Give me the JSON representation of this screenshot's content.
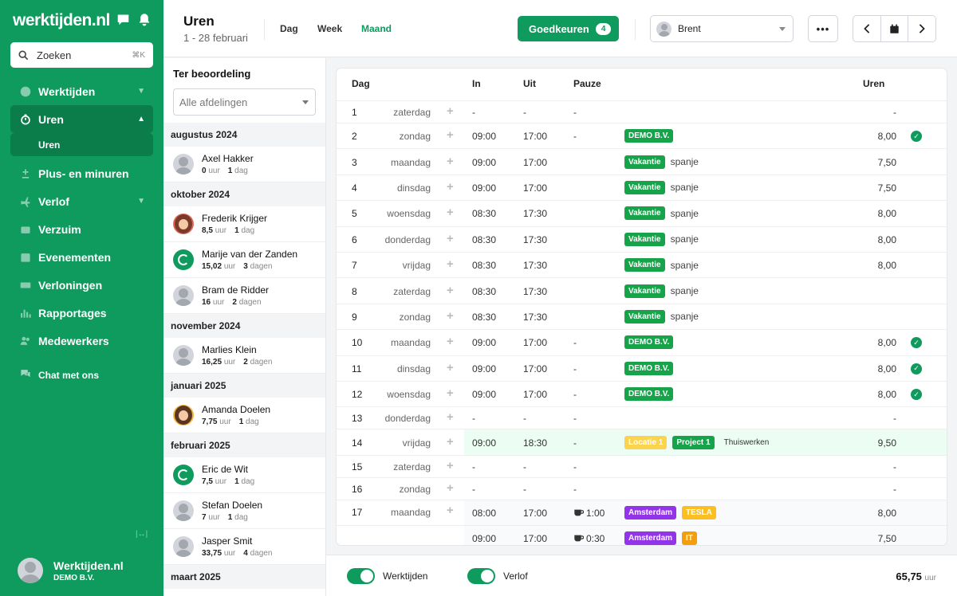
{
  "app": {
    "logo": "werktijden.nl"
  },
  "sidebar": {
    "search_label": "Zoeken",
    "search_shortcut": "⌘K",
    "items": [
      {
        "label": "Werktijden",
        "name": "werktijden"
      },
      {
        "label": "Uren",
        "name": "uren"
      },
      {
        "label": "Plus- en minuren",
        "name": "plus-minuren"
      },
      {
        "label": "Verlof",
        "name": "verlof"
      },
      {
        "label": "Verzuim",
        "name": "verzuim"
      },
      {
        "label": "Evenementen",
        "name": "evenementen"
      },
      {
        "label": "Verloningen",
        "name": "verloningen"
      },
      {
        "label": "Rapportages",
        "name": "rapportages"
      },
      {
        "label": "Medewerkers",
        "name": "medewerkers"
      }
    ],
    "sub_item": "Uren",
    "chat": "Chat met ons",
    "profile": {
      "name": "Werktijden.nl",
      "company": "DEMO B.V."
    }
  },
  "header": {
    "title": "Uren",
    "subtitle": "1 - 28 februari",
    "tabs": [
      "Dag",
      "Week",
      "Maand"
    ],
    "approve_label": "Goedkeuren",
    "approve_count": "4",
    "user": "Brent"
  },
  "review": {
    "title": "Ter beoordeling",
    "dept_placeholder": "Alle afdelingen",
    "unit_hours": "uur",
    "groups": [
      {
        "month": "augustus 2024",
        "people": [
          {
            "name": "Axel Hakker",
            "hours": "0",
            "days": "1 dag"
          }
        ]
      },
      {
        "month": "oktober 2024",
        "people": [
          {
            "name": "Frederik Krijger",
            "hours": "8,5",
            "days": "1 dag"
          },
          {
            "name": "Marije van der Zanden",
            "hours": "15,02",
            "days": "3 dagen"
          },
          {
            "name": "Bram de Ridder",
            "hours": "16",
            "days": "2 dagen"
          }
        ]
      },
      {
        "month": "november 2024",
        "people": [
          {
            "name": "Marlies Klein",
            "hours": "16,25",
            "days": "2 dagen"
          }
        ]
      },
      {
        "month": "januari 2025",
        "people": [
          {
            "name": "Amanda Doelen",
            "hours": "7,75",
            "days": "1 dag"
          }
        ]
      },
      {
        "month": "februari 2025",
        "people": [
          {
            "name": "Eric de Wit",
            "hours": "7,5",
            "days": "1 dag"
          },
          {
            "name": "Stefan Doelen",
            "hours": "7",
            "days": "1 dag"
          },
          {
            "name": "Jasper Smit",
            "hours": "33,75",
            "days": "4 dagen"
          }
        ]
      },
      {
        "month": "maart 2025",
        "people": []
      }
    ]
  },
  "table": {
    "headers": {
      "dag": "Dag",
      "in": "In",
      "uit": "Uit",
      "pauze": "Pauze",
      "uren": "Uren"
    },
    "rows": [
      {
        "num": "1",
        "day": "zaterdag",
        "in": "-",
        "out": "-",
        "pause": "-",
        "tags": [],
        "hours": "-",
        "check": false
      },
      {
        "num": "2",
        "day": "zondag",
        "in": "09:00",
        "out": "17:00",
        "pause": "-",
        "tags": [
          {
            "t": "DEMO B.V.",
            "c": "#16a34a"
          }
        ],
        "hours": "8,00",
        "check": true
      },
      {
        "num": "3",
        "day": "maandag",
        "in": "09:00",
        "out": "17:00",
        "pause": "",
        "tags": [
          {
            "t": "Vakantie",
            "c": "#16a34a"
          },
          {
            "t": "spanje",
            "plain": true
          }
        ],
        "hours": "7,50",
        "check": false
      },
      {
        "num": "4",
        "day": "dinsdag",
        "in": "09:00",
        "out": "17:00",
        "pause": "",
        "tags": [
          {
            "t": "Vakantie",
            "c": "#16a34a"
          },
          {
            "t": "spanje",
            "plain": true
          }
        ],
        "hours": "7,50",
        "check": false
      },
      {
        "num": "5",
        "day": "woensdag",
        "in": "08:30",
        "out": "17:30",
        "pause": "",
        "tags": [
          {
            "t": "Vakantie",
            "c": "#16a34a"
          },
          {
            "t": "spanje",
            "plain": true
          }
        ],
        "hours": "8,00",
        "check": false
      },
      {
        "num": "6",
        "day": "donderdag",
        "in": "08:30",
        "out": "17:30",
        "pause": "",
        "tags": [
          {
            "t": "Vakantie",
            "c": "#16a34a"
          },
          {
            "t": "spanje",
            "plain": true
          }
        ],
        "hours": "8,00",
        "check": false
      },
      {
        "num": "7",
        "day": "vrijdag",
        "in": "08:30",
        "out": "17:30",
        "pause": "",
        "tags": [
          {
            "t": "Vakantie",
            "c": "#16a34a"
          },
          {
            "t": "spanje",
            "plain": true
          }
        ],
        "hours": "8,00",
        "check": false
      },
      {
        "num": "8",
        "day": "zaterdag",
        "in": "08:30",
        "out": "17:30",
        "pause": "",
        "tags": [
          {
            "t": "Vakantie",
            "c": "#16a34a"
          },
          {
            "t": "spanje",
            "plain": true
          }
        ],
        "hours": "",
        "check": false
      },
      {
        "num": "9",
        "day": "zondag",
        "in": "08:30",
        "out": "17:30",
        "pause": "",
        "tags": [
          {
            "t": "Vakantie",
            "c": "#16a34a"
          },
          {
            "t": "spanje",
            "plain": true
          }
        ],
        "hours": "",
        "check": false
      },
      {
        "num": "10",
        "day": "maandag",
        "in": "09:00",
        "out": "17:00",
        "pause": "-",
        "tags": [
          {
            "t": "DEMO B.V.",
            "c": "#16a34a"
          }
        ],
        "hours": "8,00",
        "check": true
      },
      {
        "num": "11",
        "day": "dinsdag",
        "in": "09:00",
        "out": "17:00",
        "pause": "-",
        "tags": [
          {
            "t": "DEMO B.V.",
            "c": "#16a34a"
          }
        ],
        "hours": "8,00",
        "check": true
      },
      {
        "num": "12",
        "day": "woensdag",
        "in": "09:00",
        "out": "17:00",
        "pause": "-",
        "tags": [
          {
            "t": "DEMO B.V.",
            "c": "#16a34a"
          }
        ],
        "hours": "8,00",
        "check": true
      },
      {
        "num": "13",
        "day": "donderdag",
        "in": "-",
        "out": "-",
        "pause": "-",
        "tags": [],
        "hours": "-",
        "check": false
      },
      {
        "num": "14",
        "day": "vrijdag",
        "in": "09:00",
        "out": "18:30",
        "pause": "-",
        "tags": [
          {
            "t": "Locatie 1",
            "c": "#fcd34d"
          },
          {
            "t": "Project 1",
            "c": "#16a34a"
          },
          {
            "t": "Thuiswerken",
            "gray": true
          }
        ],
        "hours": "9,50",
        "check": false,
        "highlight": true
      },
      {
        "num": "15",
        "day": "zaterdag",
        "in": "-",
        "out": "-",
        "pause": "-",
        "tags": [],
        "hours": "-",
        "check": false
      },
      {
        "num": "16",
        "day": "zondag",
        "in": "-",
        "out": "-",
        "pause": "-",
        "tags": [],
        "hours": "-",
        "check": false
      },
      {
        "num": "17",
        "day": "maandag",
        "in": "08:00",
        "out": "17:00",
        "pause": "1:00",
        "pause_icon": true,
        "tags": [
          {
            "t": "Amsterdam",
            "c": "#9333ea"
          },
          {
            "t": "TESLA",
            "c": "#fbbf24"
          }
        ],
        "hours": "8,00",
        "check": false,
        "gray": true
      },
      {
        "num": "",
        "day": "",
        "in": "09:00",
        "out": "17:00",
        "pause": "0:30",
        "pause_icon": true,
        "tags": [
          {
            "t": "Amsterdam",
            "c": "#9333ea"
          },
          {
            "t": "IT",
            "c": "#f59e0b"
          }
        ],
        "hours": "7,50",
        "check": false,
        "gray": true,
        "noplus": true
      }
    ]
  },
  "footer": {
    "toggle1": "Werktijden",
    "toggle2": "Verlof",
    "total": "65,75",
    "total_unit": "uur"
  },
  "colors": {
    "brand": "#0f9a5e",
    "brand_dark": "#0b7d4a"
  }
}
